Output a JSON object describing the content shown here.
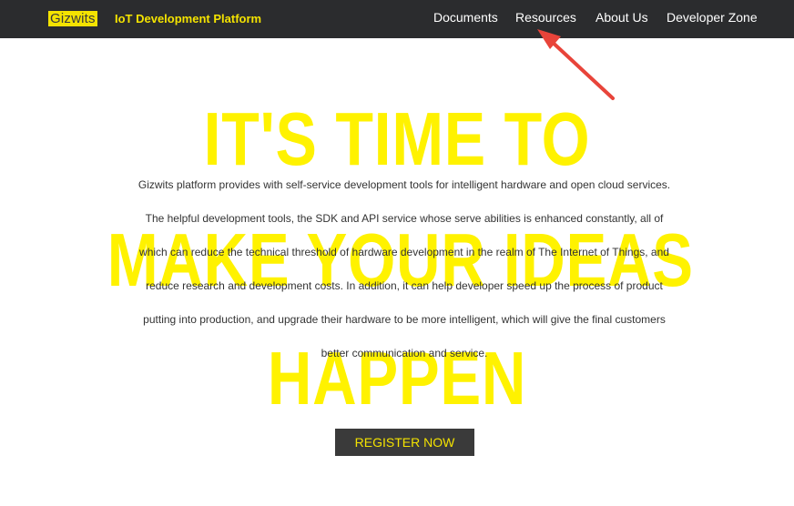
{
  "header": {
    "logo_text": "Gizwits",
    "platform_name": "IoT Development Platform",
    "nav": [
      {
        "label": "Documents"
      },
      {
        "label": "Resources"
      },
      {
        "label": "About Us"
      },
      {
        "label": "Developer Zone"
      }
    ]
  },
  "hero": {
    "line1": "IT'S TIME TO",
    "line2": "MAKE YOUR IDEAS",
    "line3": "HAPPEN"
  },
  "description": {
    "lines": [
      "Gizwits platform provides with self-service development tools for intelligent hardware and open cloud services.",
      "The helpful development tools, the SDK and API service whose serve abilities is enhanced constantly, all of",
      "which can reduce the technical threshold of hardware development in the realm of The Internet of Things, and",
      "reduce research and development costs. In addition, it can help developer speed up the process of product",
      "putting into production, and upgrade their hardware to be more intelligent, which will give the final customers",
      "better communication and service."
    ]
  },
  "cta": {
    "register_label": "REGISTER NOW"
  },
  "colors": {
    "navbar_bg": "#2b2c2e",
    "brand_yellow": "#f4e300",
    "hero_yellow": "#fff200",
    "annotation_red": "#e8443a"
  }
}
